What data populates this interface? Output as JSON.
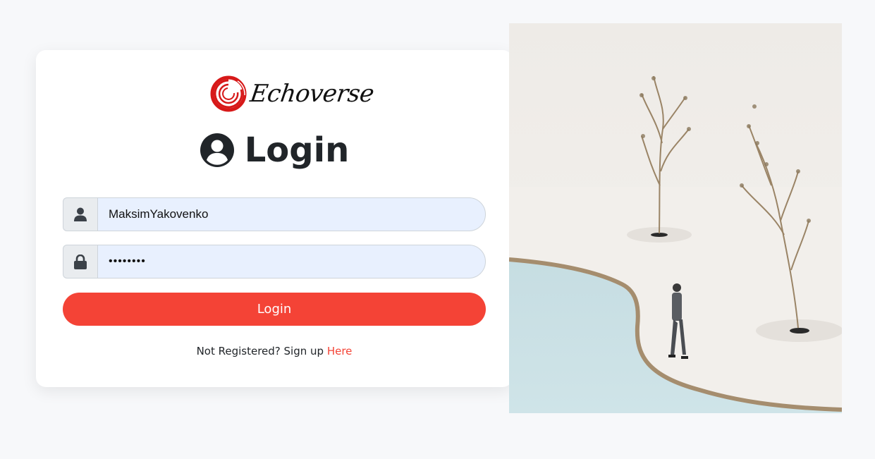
{
  "brand": {
    "name": "Echoverse",
    "accent": "#f44336",
    "logo_color": "#d71919"
  },
  "heading": {
    "icon": "user-circle-icon",
    "title": "Login"
  },
  "form": {
    "username": {
      "icon": "user-icon",
      "value": "MaksimYakovenko"
    },
    "password": {
      "icon": "lock-icon",
      "value": "••••••••"
    },
    "submit_label": "Login"
  },
  "signup": {
    "prompt": "Not Registered? Sign up",
    "link_label": "Here"
  },
  "hero_image": {
    "subject": "man-walking-by-pool-with-trees"
  }
}
